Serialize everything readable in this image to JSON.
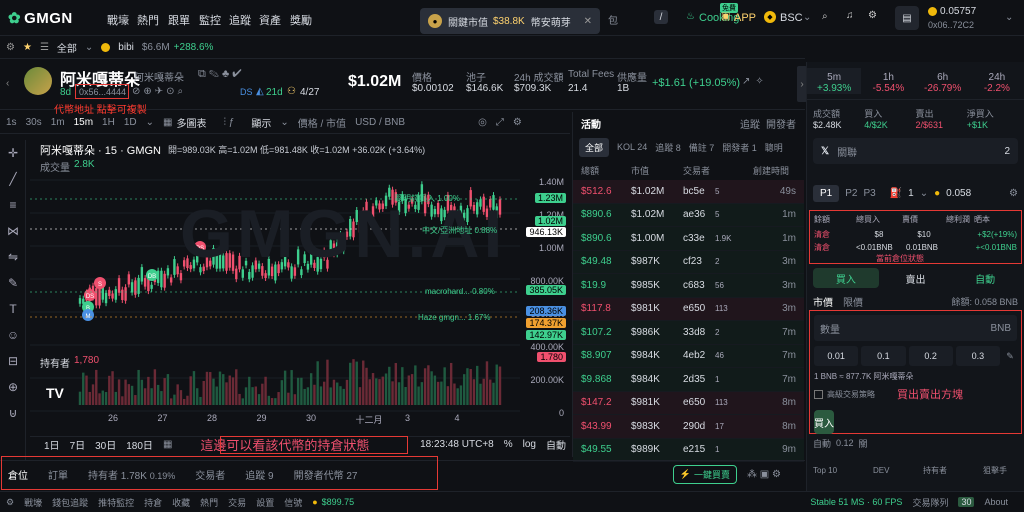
{
  "nav": {
    "logo": "GMGN",
    "items": [
      "戰壕",
      "熱門",
      "跟單",
      "監控",
      "追蹤",
      "資產",
      "獎勵"
    ],
    "search_hint": "包",
    "slash": "/",
    "cooking": "Cooking",
    "free": "免費",
    "app": "APP",
    "chain": "BSC",
    "balance": "0.05757",
    "address": "0x06..72C2"
  },
  "toast": {
    "label": "關鍵市值",
    "value": "$38.8K",
    "token": "幣安萌芽"
  },
  "subbar": {
    "all": "全部",
    "fav_token": "bibi",
    "fav_mc": "$6.6M",
    "fav_chg": "+288.6%"
  },
  "token": {
    "name": "阿米嘎蒂朵",
    "sub": "阿米嘎蒂朵",
    "age": "8d",
    "address": "0x56...4444",
    "age2": "21d",
    "holders_ratio": "4/27",
    "ds": "DS",
    "mc": "$1.02M",
    "price_label": "價格",
    "price": "$0.00102",
    "pool_label": "池子",
    "pool": "$146.6K",
    "vol_label": "24h 成交額",
    "vol": "$709.3K",
    "fees_label": "Total Fees",
    "fees": "21.4",
    "supply_label": "供應量",
    "supply": "1B",
    "change": "+$1.61 (+19.05%)"
  },
  "annot": {
    "address_note": "代幣地址 點擊可複製",
    "holdings_note": "這邊可以看該代幣的持倉狀態",
    "sell_note": "買出賣出方塊",
    "position_note": "當前倉位狀態"
  },
  "chart_tools": {
    "intervals": [
      "1s",
      "30s",
      "1m",
      "15m",
      "1H",
      "1D"
    ],
    "multi": "多圖表",
    "display": "顯示",
    "price_mc": "價格 / 市值",
    "usd_bnb": "USD / BNB"
  },
  "chart": {
    "title": "阿米嘎蒂朵 · 15 · GMGN",
    "ohlc": "開=989.03K 高=1.02M 低=981.48K 收=1.02M +36.02K (+3.64%)",
    "vol_label": "成交量",
    "vol_val": "2.8K",
    "holders_label": "持有者",
    "holders_val": "1,780",
    "ylabels": [
      "1.40M",
      "1.20M",
      "1.00M",
      "800.00K",
      "600.00K",
      "400.00K",
      "200.00K",
      "0"
    ],
    "tags": [
      "1.23M",
      "1.02M",
      "946.13K",
      "385.05K",
      "208.36K",
      "174.37K",
      "142.97K",
      "1.780"
    ],
    "xlabels": [
      "26",
      "27",
      "28",
      "29",
      "30",
      "十二月",
      "3",
      "4"
    ],
    "notes": [
      "聰明錢買入 1.00%",
      "中文/亞洲地址 0.88%",
      "macrohard... 0.80%",
      "Haze gmgn... 1.67%"
    ],
    "watermark": "GMGN.AI",
    "ranges": [
      "1日",
      "7日",
      "30日",
      "180日"
    ],
    "time": "18:23:48 UTC+8",
    "pct": "%",
    "log": "log",
    "auto": "自動"
  },
  "chart_data": {
    "type": "line",
    "title": "阿米嘎蒂朵 · 15 · GMGN",
    "x": [
      "26",
      "27",
      "28",
      "29",
      "30",
      "十二月",
      "3",
      "4"
    ],
    "values": [
      200,
      330,
      560,
      460,
      520,
      1150,
      1050,
      1020
    ],
    "ylim": [
      0,
      1400
    ],
    "ylabel": "",
    "xlabel": ""
  },
  "activity": {
    "title": "活動",
    "track": "追蹤",
    "dev": "開發者",
    "tabs": [
      "全部",
      "KOL 24",
      "追蹤 8",
      "備註 7",
      "開發者 1",
      "聰明"
    ],
    "cols": [
      "總額",
      "市值",
      "交易者",
      "創建時間"
    ],
    "rows": [
      {
        "amt": "$512.6",
        "mc": "$1.02M",
        "who": "bc5e",
        "tag": "5",
        "t": "49s",
        "buy": false
      },
      {
        "amt": "$890.6",
        "mc": "$1.02M",
        "who": "ae36",
        "tag": "5",
        "t": "1m",
        "buy": true
      },
      {
        "amt": "$890.6",
        "mc": "$1.00M",
        "who": "c33e",
        "tag": "1.9K",
        "t": "1m",
        "buy": true
      },
      {
        "amt": "$49.48",
        "mc": "$987K",
        "who": "cf23",
        "tag": "2",
        "t": "3m",
        "buy": true
      },
      {
        "amt": "$19.9",
        "mc": "$985K",
        "who": "c683",
        "tag": "56",
        "t": "3m",
        "buy": true
      },
      {
        "amt": "$117.8",
        "mc": "$981K",
        "who": "e650",
        "tag": "113",
        "t": "3m",
        "buy": false
      },
      {
        "amt": "$107.2",
        "mc": "$986K",
        "who": "33d8",
        "tag": "2",
        "t": "7m",
        "buy": true
      },
      {
        "amt": "$8.907",
        "mc": "$984K",
        "who": "4eb2",
        "tag": "46",
        "t": "7m",
        "buy": true
      },
      {
        "amt": "$9.868",
        "mc": "$984K",
        "who": "2d35",
        "tag": "1",
        "t": "7m",
        "buy": true
      },
      {
        "amt": "$147.2",
        "mc": "$981K",
        "who": "e650",
        "tag": "113",
        "t": "8m",
        "buy": false
      },
      {
        "amt": "$43.99",
        "mc": "$983K",
        "who": "290d",
        "tag": "17",
        "t": "8m",
        "buy": false
      },
      {
        "amt": "$49.55",
        "mc": "$989K",
        "who": "e215",
        "tag": "1",
        "t": "9m",
        "buy": true
      }
    ]
  },
  "right": {
    "periods": [
      {
        "p": "5m",
        "c": "+3.93%"
      },
      {
        "p": "1h",
        "c": "-5.54%"
      },
      {
        "p": "6h",
        "c": "-26.79%"
      },
      {
        "p": "24h",
        "c": "-2.2%"
      }
    ],
    "stats": [
      {
        "k": "成交額",
        "v": "$2.48K"
      },
      {
        "k": "買入",
        "v": "4/$2K"
      },
      {
        "k": "賣出",
        "v": "2/$631"
      },
      {
        "k": "淨買入",
        "v": "+$1K"
      }
    ],
    "follow": "關聯",
    "follow_n": "2",
    "presets": [
      "P1",
      "P2",
      "P3"
    ],
    "slip": "1",
    "gas": "0.058",
    "pos_cols": [
      "餘額",
      "總買入",
      "賣價",
      "總利潤",
      "晒本"
    ],
    "pos_r1": [
      "清倉",
      "$8",
      "$10",
      "+$2(+19%)"
    ],
    "pos_r2": [
      "清倉",
      "<0.01BNB",
      "0.01BNB",
      "+<0.01BNB"
    ],
    "buy": "買入",
    "sell": "賣出",
    "auto": "自動",
    "market": "市價",
    "limit": "限價",
    "bal": "餘額: 0.058 BNB",
    "qty": "數量",
    "unit": "BNB",
    "amounts": [
      "0.01",
      "0.1",
      "0.2",
      "0.3"
    ],
    "rate": "1 BNB ≈ 877.7K 阿米嘎蒂朵",
    "adv": "高級交易策略",
    "buy_btn": "買入",
    "auto2": "自動",
    "gas2": "0.12",
    "off": "關",
    "top10": "Top 10",
    "devl": "DEV",
    "holders": "持有者",
    "sniper": "狙擊手"
  },
  "btabs": {
    "items": [
      "倉位",
      "訂單",
      "持有者 1.78K",
      "交易者",
      "追蹤 9",
      "開發者代幣 27"
    ],
    "ratio": "0.19%",
    "quick": "一鍵買賣"
  },
  "status": {
    "items": [
      "戰壕",
      "錢包追蹤",
      "推特監控",
      "持倉",
      "收藏",
      "熱門",
      "交易",
      "設置",
      "信號"
    ],
    "price": "$899.75",
    "stable": "Stable 51 MS · 60 FPS",
    "queue": "交易隊列",
    "queue_n": "30",
    "about": "About"
  }
}
